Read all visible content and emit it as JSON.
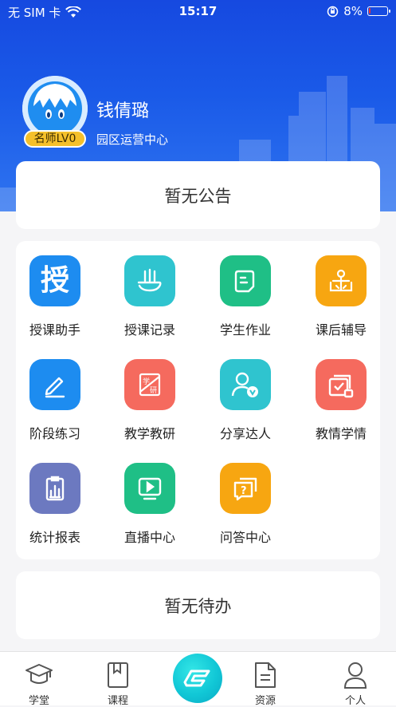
{
  "status_bar": {
    "carrier": "无 SIM 卡",
    "time": "15:17",
    "battery": "8%",
    "battery_level": 0.08
  },
  "profile": {
    "name": "钱倩璐",
    "department": "园区运营中心",
    "level": "名师LV0"
  },
  "notice": {
    "text": "暂无公告"
  },
  "features": [
    {
      "label": "授课助手",
      "icon": "teaching-assistant-icon",
      "color": "#1d8cf0"
    },
    {
      "label": "授课记录",
      "icon": "teaching-record-icon",
      "color": "#2fc4cf"
    },
    {
      "label": "学生作业",
      "icon": "homework-icon",
      "color": "#1fbf86"
    },
    {
      "label": "课后辅导",
      "icon": "tutoring-icon",
      "color": "#f7a611"
    },
    {
      "label": "阶段练习",
      "icon": "practice-icon",
      "color": "#1d8cf0"
    },
    {
      "label": "教学教研",
      "icon": "research-icon",
      "color": "#f56a5e"
    },
    {
      "label": "分享达人",
      "icon": "share-expert-icon",
      "color": "#2fc4cf"
    },
    {
      "label": "教情学情",
      "icon": "teaching-status-icon",
      "color": "#f56a5e"
    },
    {
      "label": "统计报表",
      "icon": "report-icon",
      "color": "#6c79c0"
    },
    {
      "label": "直播中心",
      "icon": "live-icon",
      "color": "#1fbf86"
    },
    {
      "label": "问答中心",
      "icon": "qa-icon",
      "color": "#f7a611"
    }
  ],
  "todo": {
    "text": "暂无待办"
  },
  "tabbar": [
    {
      "label": "学堂",
      "icon": "school-icon"
    },
    {
      "label": "课程",
      "icon": "course-icon"
    },
    {
      "label": "",
      "icon": "center-logo-icon"
    },
    {
      "label": "资源",
      "icon": "resource-icon"
    },
    {
      "label": "个人",
      "icon": "person-icon"
    }
  ]
}
